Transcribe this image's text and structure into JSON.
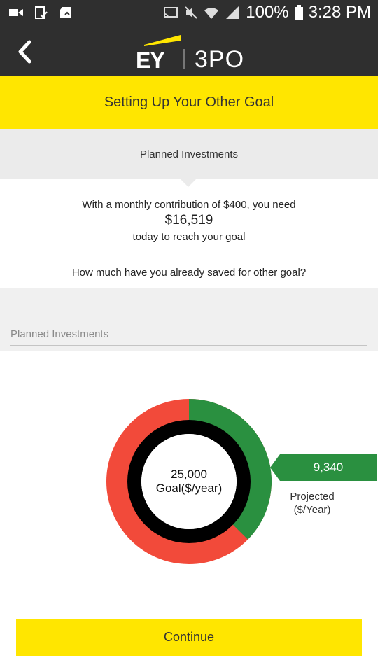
{
  "status_bar": {
    "battery_percent": "100%",
    "time": "3:28 PM",
    "icons": [
      "video-icon",
      "tablet-check-icon",
      "sd-card-icon",
      "cast-icon",
      "mute-icon",
      "wifi-icon",
      "signal-icon",
      "battery-icon"
    ]
  },
  "app_bar": {
    "logo_primary": "EY",
    "logo_secondary": "3PO",
    "back_icon": "chevron-left-icon"
  },
  "title": "Setting Up Your Other Goal",
  "section_header": "Planned Investments",
  "message": {
    "line1": "With a monthly contribution of $400, you need",
    "amount": "$16,519",
    "line3": "today to reach your goal"
  },
  "question": "How much have you already saved for other goal?",
  "input": {
    "placeholder": "Planned Investments",
    "value": ""
  },
  "chart": {
    "goal_value": "25,000",
    "goal_label": "Goal($/year)",
    "projected_value": "9,340",
    "projected_label_line1": "Projected",
    "projected_label_line2": "($/Year)",
    "goal_number": 25000,
    "projected_number": 9340,
    "projected_color": "#2a9040",
    "remaining_color": "#f24a3a",
    "inner_ring_color": "#000000"
  },
  "continue_label": "Continue",
  "colors": {
    "accent_yellow": "#ffe600",
    "dark_bar": "#2f2f2f",
    "section_gray": "#ebebeb"
  }
}
